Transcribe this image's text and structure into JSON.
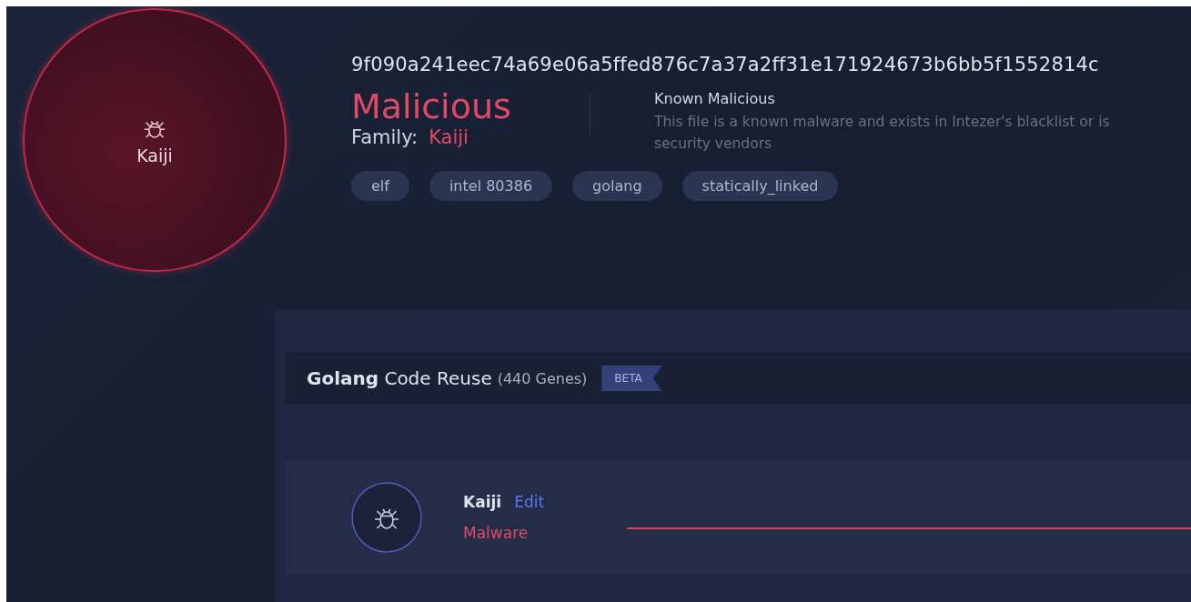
{
  "verdict_circle": {
    "family": "Kaiji"
  },
  "hash": "9f090a241eec74a69e06a5ffed876c7a37a2ff31e171924673b6bb5f1552814c",
  "verdict": {
    "label": "Malicious",
    "family_label": "Family:",
    "family": "Kaiji"
  },
  "classification": {
    "title": "Known Malicious",
    "description_lines": [
      "This file is a known malware and exists in Intezer's blacklist or is",
      "security vendors"
    ]
  },
  "tags": [
    "elf",
    "intel 80386",
    "golang",
    "statically_linked"
  ],
  "code_reuse": {
    "title_bold": "Golang",
    "title": "Code Reuse",
    "count": "(440 Genes)",
    "badge": "BETA",
    "families": [
      {
        "name": "Kaiji",
        "action": "Edit",
        "type": "Malware"
      }
    ]
  }
}
